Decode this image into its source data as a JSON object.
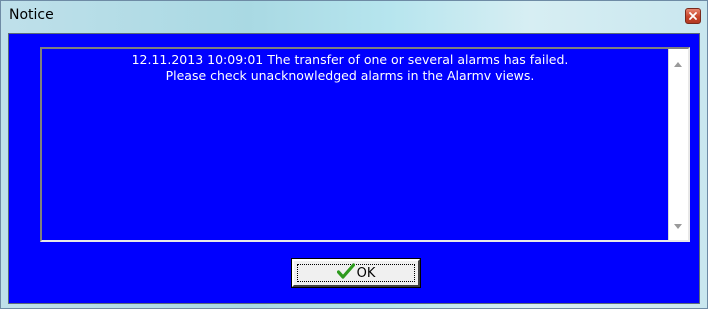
{
  "window": {
    "title": "Notice"
  },
  "message": {
    "line1": "12.11.2013 10:09:01  The transfer of one or several alarms has failed.",
    "line2": "Please check unacknowledged alarms in the Alarmv views."
  },
  "buttons": {
    "ok_label": "OK"
  },
  "colors": {
    "client_background": "#0000ff",
    "message_text": "#ffffff",
    "checkmark": "#2e9a1e",
    "close_button": "#c8452a"
  },
  "icons": {
    "close": "close-icon",
    "ok": "checkmark-icon",
    "scroll_up": "scroll-up-arrow-icon",
    "scroll_down": "scroll-down-arrow-icon"
  }
}
